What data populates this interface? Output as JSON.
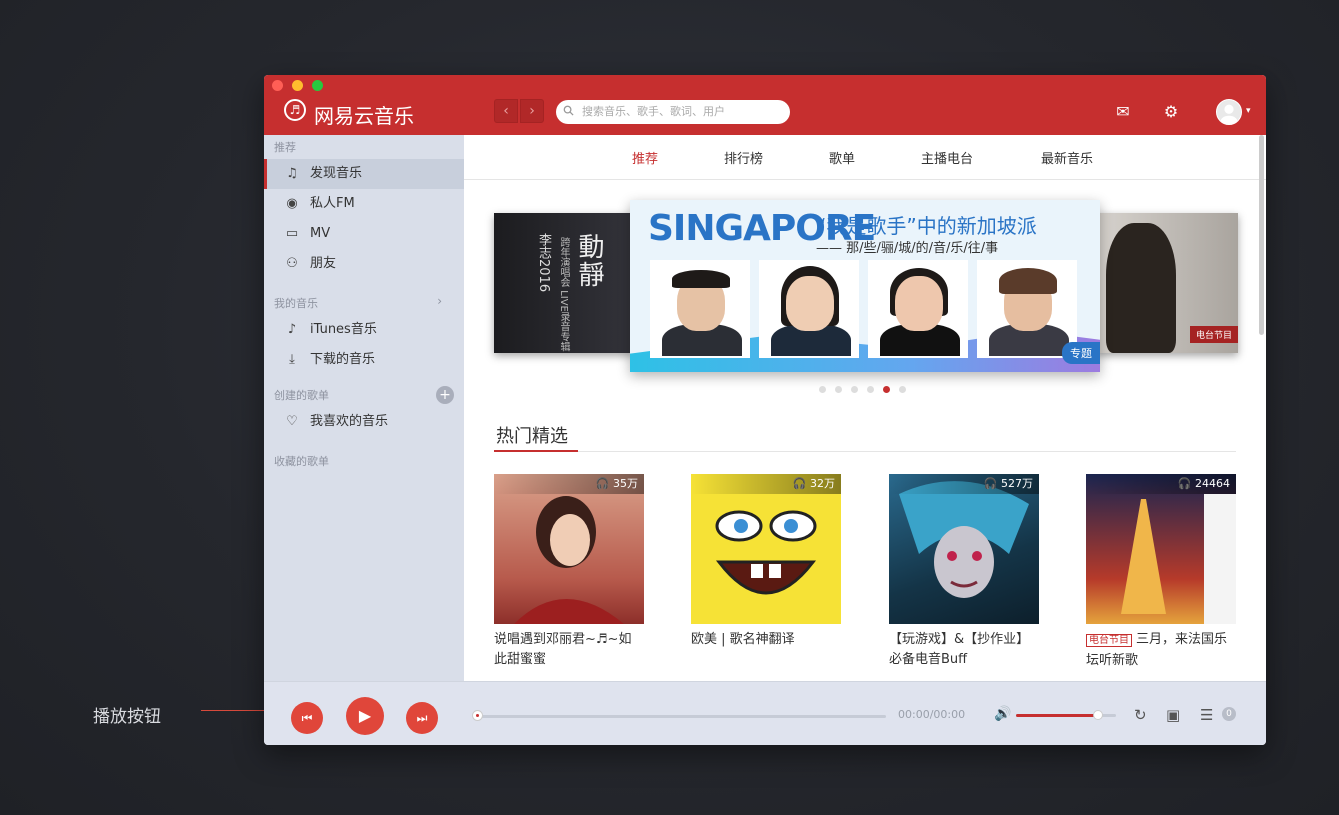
{
  "annotation": {
    "label": "播放按钮"
  },
  "header": {
    "brand": "网易云音乐",
    "logo_char": "♬",
    "nav_back": "‹",
    "nav_forward": "›",
    "search_placeholder": "搜索音乐、歌手、歌词、用户",
    "mail_icon": "✉",
    "settings_icon": "⚙",
    "avatar_caret": "▾"
  },
  "sidebar": {
    "sections": [
      {
        "title": "推荐"
      },
      {
        "title": "我的音乐",
        "arrow": "›"
      },
      {
        "title": "创建的歌单",
        "plus": "+"
      },
      {
        "title": "收藏的歌单"
      }
    ],
    "recommend_items": [
      {
        "icon": "♫",
        "label": "发现音乐",
        "active": true
      },
      {
        "icon": "◉",
        "label": "私人FM"
      },
      {
        "icon": "▭",
        "label": "MV"
      },
      {
        "icon": "⚇",
        "label": "朋友"
      }
    ],
    "music_items": [
      {
        "icon": "♪",
        "label": "iTunes音乐"
      },
      {
        "icon": "⤓",
        "label": "下载的音乐"
      }
    ],
    "playlist_items": [
      {
        "icon": "♡",
        "label": "我喜欢的音乐"
      }
    ]
  },
  "tabs": [
    "推荐",
    "排行榜",
    "歌单",
    "主播电台",
    "最新音乐"
  ],
  "banner": {
    "title": "SINGAPORE",
    "quote": "“我是歌手”中的新加坡派",
    "subline": "—— 那/些/骊/城/的/音/乐/往/事",
    "tag": "专题",
    "left_text": "李志2016",
    "left_sub": "跨年演唱会 LIVE录音专辑",
    "left_big": "動靜",
    "right_tag": "电台节目",
    "dots": 6,
    "active_dot": 4
  },
  "hot": {
    "title": "热门精选",
    "cards": [
      {
        "plays": "35万",
        "title": "说唱遇到邓丽君~♬~如此甜蜜蜜"
      },
      {
        "plays": "32万",
        "title": "欧美 | 歌名神翻译"
      },
      {
        "plays": "527万",
        "title": "【玩游戏】&【抄作业】必备电音Buff"
      },
      {
        "plays": "24464",
        "tag": "电台节目",
        "title": "三月，来法国乐坛听新歌"
      }
    ]
  },
  "player": {
    "prev_icon": "⏮",
    "play_icon": "▶",
    "next_icon": "⏭",
    "time": "00:00/00:00",
    "volume_fraction": 0.82,
    "progress_fraction": 0.0,
    "volume_icon": "🔊",
    "loop_icon": "↻",
    "lyrics_icon": "▣",
    "list_icon": "☰",
    "list_count": "0"
  }
}
